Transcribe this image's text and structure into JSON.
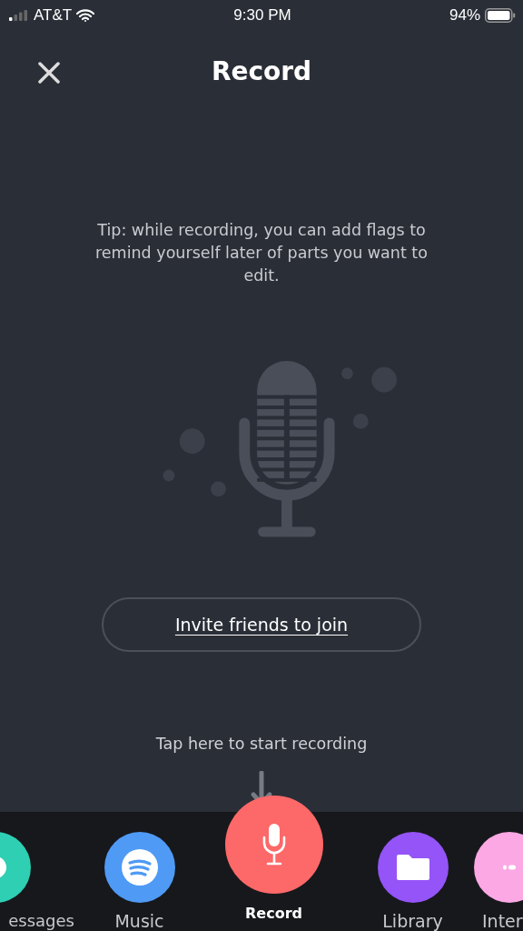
{
  "status_bar": {
    "carrier": "AT&T",
    "time": "9:30 PM",
    "battery": "94%"
  },
  "header": {
    "title": "Record"
  },
  "tip": "Tip: while recording, you can add flags to remind yourself later of parts you want to edit.",
  "invite_button": "Invite friends to join",
  "hint": "Tap here to start recording",
  "dock": [
    {
      "kind": "messages",
      "label": "essages",
      "color": "#2ecfb3",
      "selected": false
    },
    {
      "kind": "music",
      "label": "Music",
      "color": "#4f9af5",
      "selected": false
    },
    {
      "kind": "record",
      "label": "Record",
      "color": "#fd6868",
      "selected": true
    },
    {
      "kind": "library",
      "label": "Library",
      "color": "#9454f7",
      "selected": false
    },
    {
      "kind": "more",
      "label": "Inter",
      "color": "#fca8e4",
      "selected": false
    }
  ]
}
